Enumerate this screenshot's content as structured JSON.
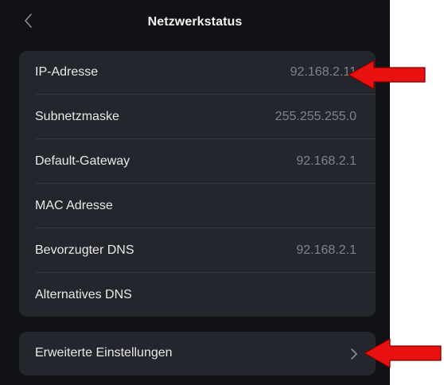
{
  "header": {
    "title": "Netzwerkstatus",
    "back_icon": "chevron-left-icon"
  },
  "network": {
    "rows": [
      {
        "label": "IP-Adresse",
        "value": "92.168.2.11"
      },
      {
        "label": "Subnetzmaske",
        "value": "255.255.255.0"
      },
      {
        "label": "Default-Gateway",
        "value": "92.168.2.1"
      },
      {
        "label": "MAC Adresse",
        "value": ""
      },
      {
        "label": "Bevorzugter DNS",
        "value": "92.168.2.1"
      },
      {
        "label": "Alternatives DNS",
        "value": ""
      }
    ]
  },
  "advanced": {
    "label": "Erweiterte Einstellungen",
    "icon": "chevron-right-icon"
  },
  "colors": {
    "background": "#111215",
    "card": "#23262c",
    "value_text": "#80838a",
    "annotation_arrow": "#e8110f"
  }
}
